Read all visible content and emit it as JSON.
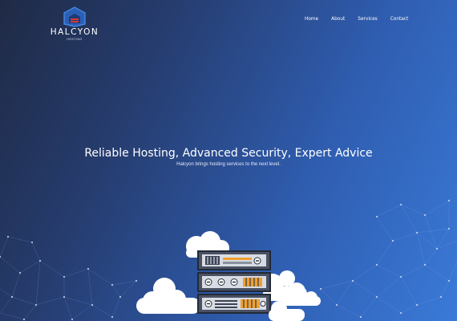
{
  "brand": {
    "name": "HALCYON",
    "tagline": "HOSTING"
  },
  "nav": {
    "items": [
      {
        "label": "Home"
      },
      {
        "label": "About"
      },
      {
        "label": "Services"
      },
      {
        "label": "Contact"
      }
    ]
  },
  "hero": {
    "title": "Reliable Hosting, Advanced Security, Expert Advice",
    "subtitle": "Halcyon brings hosting services to the next level."
  },
  "illustration": {
    "icon": "server-rack-with-clouds",
    "accent_color": "#f0a030"
  },
  "colors": {
    "background_dark": "#1f2a45",
    "background_light": "#3a7ad8",
    "logo_blue": "#3b7fe0",
    "logo_red": "#d83a3a"
  }
}
